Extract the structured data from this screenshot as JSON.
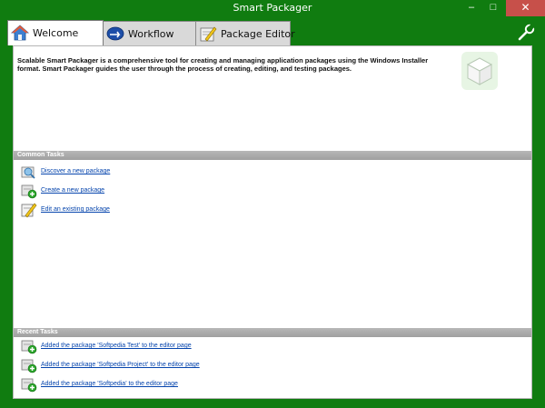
{
  "window": {
    "title": "Smart Packager",
    "minimize_glyph": "–",
    "maximize_glyph": "□",
    "close_glyph": "✕"
  },
  "tabs": [
    {
      "label": "Welcome",
      "icon": "home-icon",
      "active": true
    },
    {
      "label": "Workflow",
      "icon": "workflow-icon",
      "active": false
    },
    {
      "label": "Package Editor",
      "icon": "package-editor-icon",
      "active": false
    }
  ],
  "toolbar": {
    "settings_icon": "wrench-icon"
  },
  "welcome": {
    "intro": "Scalable Smart Packager is a comprehensive tool for creating and managing application packages using the Windows Installer format.  Smart Packager guides the user through the process of creating, editing, and testing packages.",
    "logo_icon": "cube-icon"
  },
  "common_tasks": {
    "header": "Common Tasks",
    "items": [
      {
        "label": "Discover a new package",
        "icon": "discover-package-icon"
      },
      {
        "label": "Create a new package",
        "icon": "create-package-icon"
      },
      {
        "label": "Edit an existing package",
        "icon": "edit-package-icon"
      }
    ]
  },
  "recent_tasks": {
    "header": "Recent Tasks",
    "items": [
      {
        "label": "Added the package 'Softpedia Test' to the editor page",
        "icon": "add-package-icon"
      },
      {
        "label": "Added the package 'Softpedia Project' to the editor page",
        "icon": "add-package-icon"
      },
      {
        "label": "Added the package 'Softpedia' to the editor page",
        "icon": "add-package-icon"
      }
    ]
  },
  "colors": {
    "frame": "#107c10",
    "close_button": "#c7504a",
    "link": "#0645ad",
    "section_header": "#a9a9a9"
  }
}
